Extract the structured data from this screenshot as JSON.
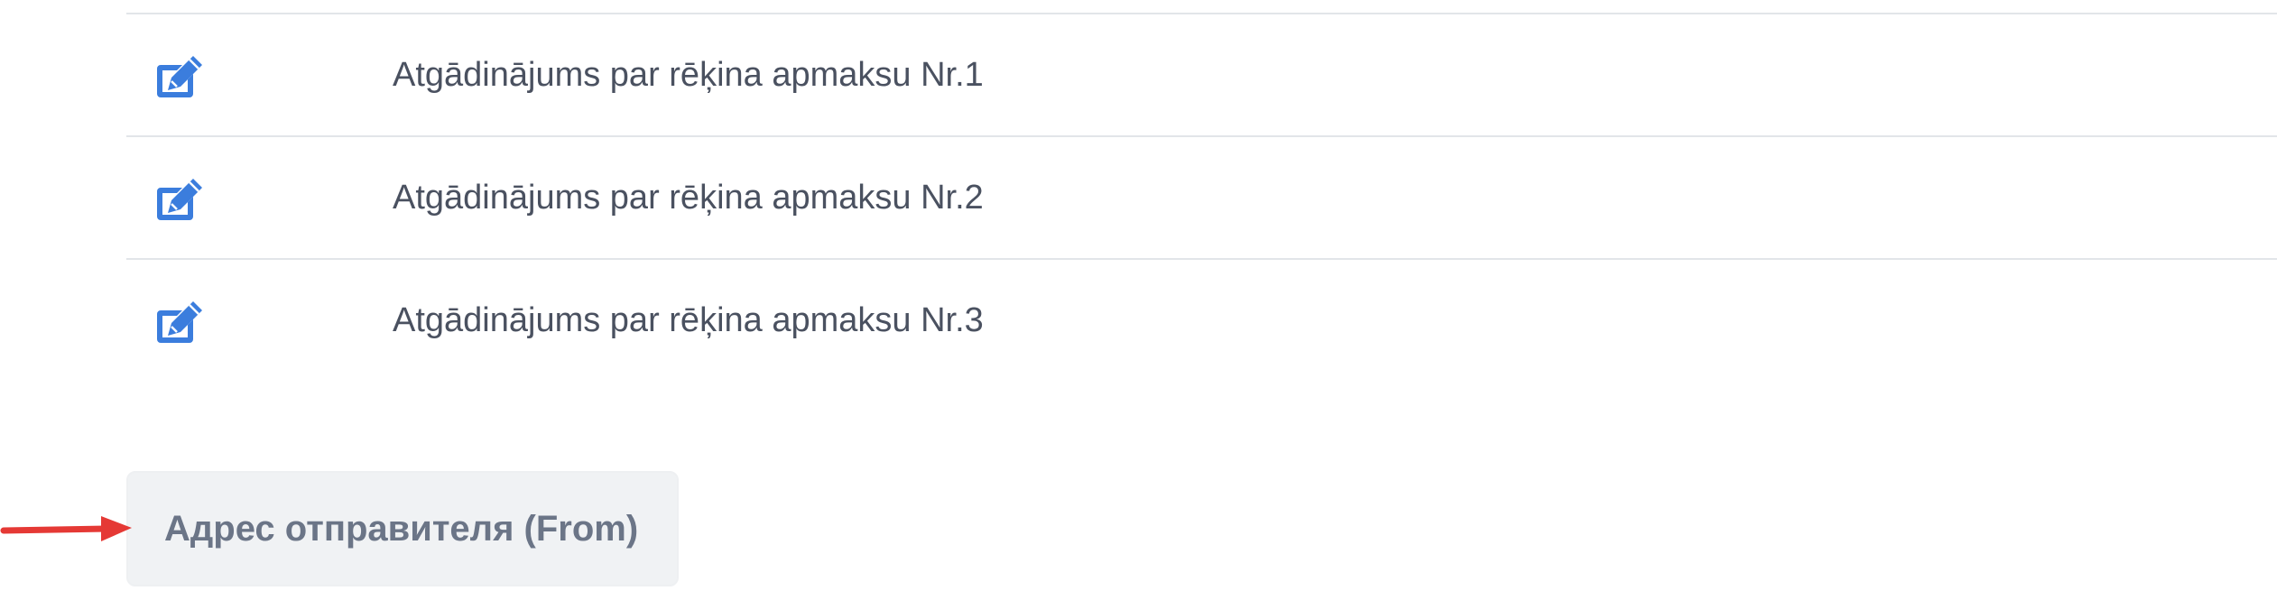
{
  "templates": {
    "items": [
      {
        "label": "Atgādinājums par rēķina apmaksu Nr.1",
        "icon": "edit-icon"
      },
      {
        "label": "Atgādinājums par rēķina apmaksu Nr.2",
        "icon": "edit-icon"
      },
      {
        "label": "Atgādinājums par rēķina apmaksu Nr.3",
        "icon": "edit-icon"
      }
    ]
  },
  "sender": {
    "button_label": "Адрес отправителя (From)"
  },
  "annotation": {
    "icon": "red-arrow",
    "color": "#e53935"
  },
  "colors": {
    "icon_blue": "#3b7ddd",
    "text": "#4a5160",
    "button_bg": "#f0f2f4",
    "button_text": "#6b7587",
    "divider": "#e2e5e9"
  }
}
